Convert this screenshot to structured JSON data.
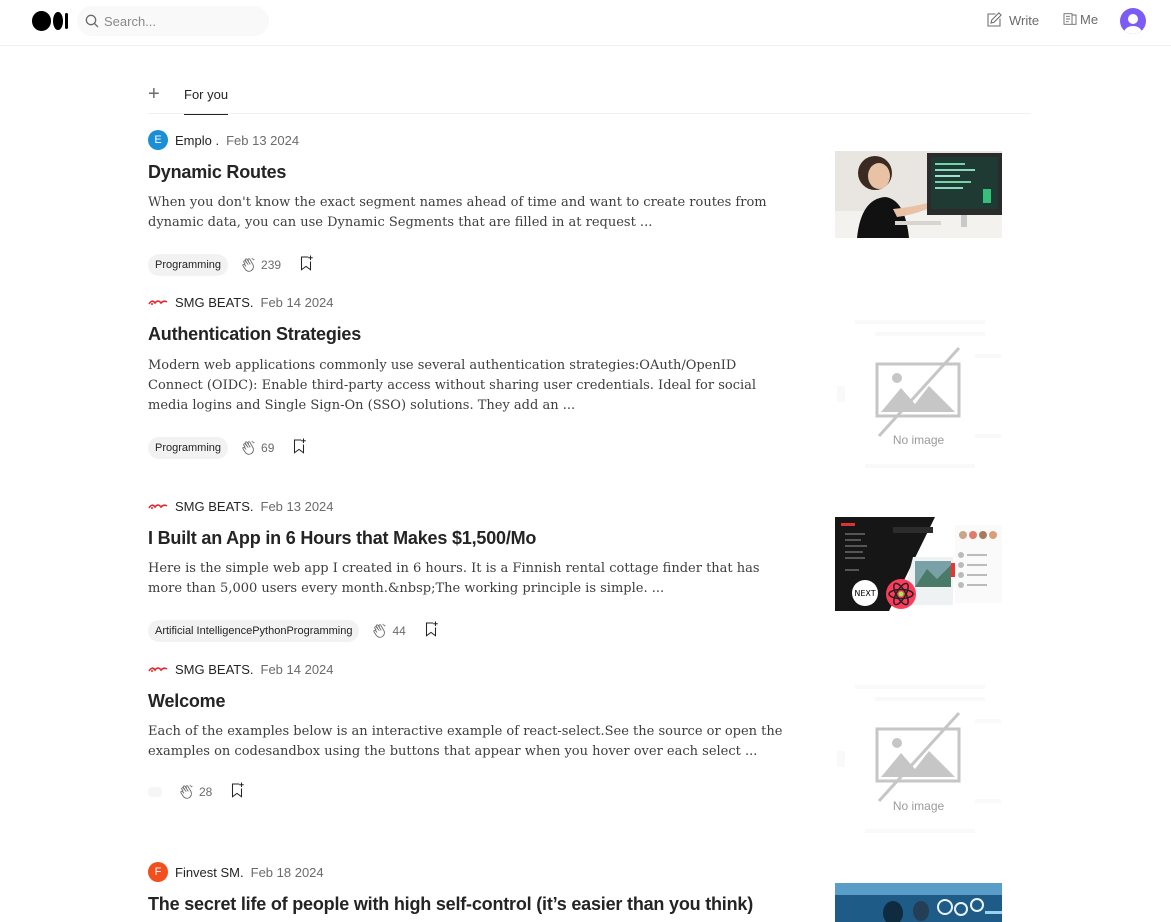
{
  "header": {
    "search_placeholder": "Search...",
    "write_label": "Write",
    "me_label": "Me"
  },
  "tabs": {
    "add_label": "+",
    "for_you_label": "For you"
  },
  "articles": [
    {
      "author": "Emplo .",
      "author_initial": "E",
      "author_color": "#1a8fd6",
      "date": "Feb 13 2024",
      "title": "Dynamic Routes",
      "excerpt": "When you don't know the exact segment names ahead of time and want to create routes from dynamic data, you can use Dynamic Segments that are filled in at request ...",
      "tag": "Programming",
      "claps": "239",
      "image": "woman-at-computer-photo"
    },
    {
      "author": "SMG BEATS.",
      "date": "Feb 14 2024",
      "title": "Authentication Strategies",
      "excerpt": "Modern web applications commonly use several authentication strategies:OAuth/OpenID Connect (OIDC): Enable third-party access without sharing user credentials. Ideal for social media logins and Single Sign-On (SSO) solutions. They add an ...",
      "tag": "Programming",
      "claps": "69",
      "image": "no-image",
      "no_image_label": "No image"
    },
    {
      "author": "SMG BEATS.",
      "date": "Feb 13 2024",
      "title": "I Built an App in 6 Hours that Makes $1,500/Mo",
      "excerpt": "Here is the simple web app I created in 6 hours. It is a Finnish rental cottage finder that has more than 5,000 users every month.&nbsp;The working principle is simple. ...",
      "tag": "Artificial IntelligencePythonProgramming",
      "claps": "44",
      "image": "nextjs-react-app-screenshot"
    },
    {
      "author": "SMG BEATS.",
      "date": "Feb 14 2024",
      "title": "Welcome",
      "excerpt": "Each of the examples below is an interactive example of react-select.See the source or open the examples on codesandbox using the buttons that appear when you hover over each select ...",
      "tag": "",
      "claps": "28",
      "image": "no-image",
      "no_image_label": "No image"
    },
    {
      "author": "Finvest SM.",
      "author_initial": "F",
      "author_color": "#f24e1e",
      "date": "Feb 18 2024",
      "title": "The secret life of people with high self-control (it’s easier than you think)",
      "image": "people-tech-photo"
    }
  ],
  "colors": {
    "text": "#242424",
    "muted": "#6b6b6b",
    "tag_bg": "#f2f2f2",
    "avatar": "#7c5cf4",
    "smg_red": "#e8232a"
  }
}
